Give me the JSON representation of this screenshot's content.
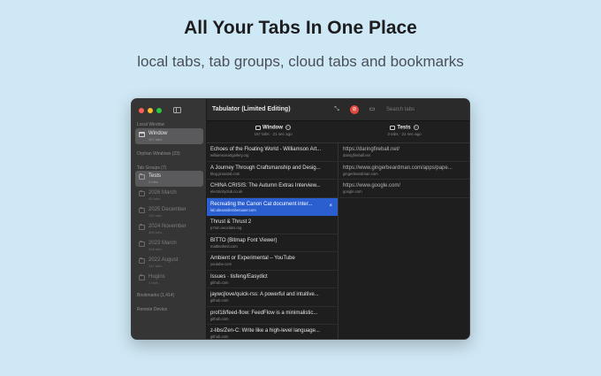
{
  "headline": "All Your Tabs In One Place",
  "subline": "local tabs, tab groups, cloud tabs and bookmarks",
  "colors": {
    "background": "#cfe8f5",
    "selection": "#2b5fd0",
    "close": "#ff5f57",
    "minimize": "#febc2e",
    "zoom": "#28c840"
  },
  "app": {
    "title": "Tabulator (Limited Editing)",
    "search_placeholder": "Search tabs"
  },
  "sidebar": {
    "local_window_label": "Local Window",
    "window_item": {
      "title": "Window",
      "subtitle": "167 tabs"
    },
    "orphan_windows": "Orphan Windows (23)",
    "tab_groups_label": "Tab Groups (7)",
    "groups": [
      {
        "title": "Tests",
        "subtitle": "3 tabs"
      },
      {
        "title": "2026 March",
        "subtitle": "45 tabs"
      },
      {
        "title": "2025 December",
        "subtitle": "116 tabs"
      },
      {
        "title": "2024 November",
        "subtitle": "466 tabs"
      },
      {
        "title": "2023 March",
        "subtitle": "348 tabs"
      },
      {
        "title": "2022 August",
        "subtitle": "342 tabs"
      },
      {
        "title": "Hugins",
        "subtitle": "4 tabs"
      }
    ],
    "bookmarks": "Bookmarks (1,414)",
    "remote_device": "Remote Device"
  },
  "columns": [
    {
      "title": "Window",
      "meta": "167 tabs · 21 sec ago"
    },
    {
      "title": "Tests",
      "meta": "3 tabs · 21 sec ago"
    }
  ],
  "window_tabs": [
    {
      "title": "Echoes of the Floating World - Williamson Art...",
      "url": "williamsonartgallery.org"
    },
    {
      "title": "A Journey Through Craftsmanship and Desig...",
      "url": "blog.prusa3d.com"
    },
    {
      "title": "CHINA CRISIS: The Autumn Extras Interview...",
      "url": "electricityclub.co.uk"
    },
    {
      "title": "Recreating the Canon Cat document inter...",
      "url": "lab.alexanderobenauer.com"
    },
    {
      "title": "Thrust & Thrust 2",
      "url": "p7om.neocities.org"
    },
    {
      "title": "BITTO (Bitmap Font Viewer)",
      "url": "mattleahmit.com"
    },
    {
      "title": "Ambient or Experimental – YouTube",
      "url": "youtube.com"
    },
    {
      "title": "Issues · tisfeng/Easydict",
      "url": "github.com"
    },
    {
      "title": "jaywcjlove/quick-rss: A powerful and intuitive...",
      "url": "github.com"
    },
    {
      "title": "prof18/feed-flow: FeedFlow is a minimalistic...",
      "url": "github.com"
    },
    {
      "title": "z-libs/Zen-C: Write like a high-level language...",
      "url": "github.com"
    }
  ],
  "group_tabs": [
    {
      "title": "https://daringfireball.net/",
      "url": "daringfireball.net"
    },
    {
      "title": "https://www.gingerbeardman.com/apps/pape...",
      "url": "gingerbeardman.com"
    },
    {
      "title": "https://www.google.com/",
      "url": "google.com"
    }
  ],
  "close_glyph": "×"
}
